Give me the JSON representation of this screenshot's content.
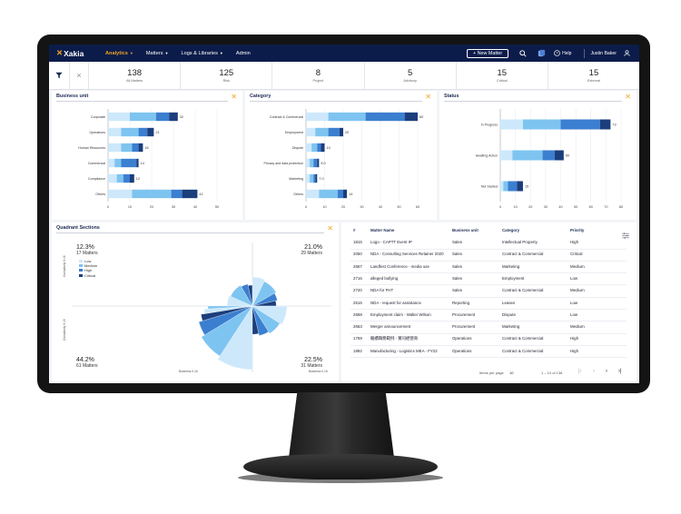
{
  "nav": {
    "logo": "Xakia",
    "items": [
      {
        "label": "Analytics",
        "active": true
      },
      {
        "label": "Matters",
        "active": false
      },
      {
        "label": "Logs & Libraries",
        "active": false
      },
      {
        "label": "Admin",
        "active": false
      }
    ],
    "new_matter": "+ New Matter",
    "help": "Help",
    "user": "Justin Baker"
  },
  "stats": [
    {
      "num": "138",
      "label": "All Matters"
    },
    {
      "num": "125",
      "label": "Risk"
    },
    {
      "num": "8",
      "label": "Project"
    },
    {
      "num": "5",
      "label": "Advisory"
    },
    {
      "num": "15",
      "label": "Critical"
    },
    {
      "num": "15",
      "label": "External"
    }
  ],
  "colors": {
    "c1": "#cde8fb",
    "c2": "#7ec4f0",
    "c3": "#3b7fd0",
    "c4": "#1b3e7c",
    "accent": "#f2a521",
    "nav": "#0c1c4a"
  },
  "business_unit": {
    "title": "Business unit",
    "chart_data": {
      "type": "bar",
      "orientation": "horizontal",
      "stacked": true,
      "categories": [
        "Corporate",
        "Operations",
        "Human Resources",
        "Commercial",
        "Compliance",
        "Others"
      ],
      "series": [
        {
          "values": [
            10,
            6,
            6,
            3,
            4,
            11
          ]
        },
        {
          "values": [
            12,
            8,
            5,
            3,
            3,
            18
          ]
        },
        {
          "values": [
            6,
            4,
            3,
            7,
            3,
            5
          ]
        },
        {
          "values": [
            4,
            3,
            2,
            1,
            2,
            7
          ]
        }
      ],
      "totals": [
        "32",
        "21",
        "16",
        "14",
        "12",
        "41"
      ],
      "xticks": [
        "0",
        "10",
        "20",
        "30",
        "40",
        "50"
      ],
      "xlim": [
        0,
        50
      ]
    }
  },
  "category": {
    "title": "Category",
    "chart_data": {
      "type": "bar",
      "orientation": "horizontal",
      "stacked": true,
      "categories": [
        "Contract & Commercial",
        "Employment",
        "Dispute",
        "Privacy and data protection",
        "Marketing",
        "Others"
      ],
      "series": [
        {
          "values": [
            12,
            5,
            3,
            2,
            2,
            7
          ]
        },
        {
          "values": [
            20,
            7,
            3,
            2,
            2,
            10
          ]
        },
        {
          "values": [
            21,
            6,
            2,
            2,
            1,
            3
          ]
        },
        {
          "values": [
            7,
            2,
            2,
            1,
            1,
            2
          ]
        }
      ],
      "totals": [
        "60",
        "20",
        "10",
        "5.0",
        "7.0",
        "14"
      ],
      "xticks": [
        "0",
        "10",
        "20",
        "30",
        "40",
        "50",
        "60"
      ],
      "xlim": [
        0,
        60
      ]
    }
  },
  "status": {
    "title": "Status",
    "chart_data": {
      "type": "bar",
      "orientation": "horizontal",
      "stacked": true,
      "categories": [
        "In Progress",
        "Awaiting Action",
        "Not Started"
      ],
      "series": [
        {
          "values": [
            15,
            8,
            2
          ]
        },
        {
          "values": [
            25,
            20,
            3
          ]
        },
        {
          "values": [
            26,
            8,
            6
          ]
        },
        {
          "values": [
            7,
            6,
            4
          ]
        }
      ],
      "totals": [
        "73",
        "50",
        "15"
      ],
      "xticks": [
        "0",
        "10",
        "20",
        "30",
        "40",
        "50",
        "60",
        "70",
        "80"
      ],
      "xlim": [
        0,
        80
      ]
    }
  },
  "quadrant": {
    "title": "Quadrant Sections",
    "legend": [
      "Low",
      "Medium",
      "High",
      "Critical"
    ],
    "q1": {
      "pct": "12.3%",
      "matters": "17 Matters"
    },
    "q2": {
      "pct": "21.0%",
      "matters": "29 Matters"
    },
    "q3": {
      "pct": "44.2%",
      "matters": "61 Matters"
    },
    "q4": {
      "pct": "22.5%",
      "matters": "31 Matters"
    },
    "axis_left_top": "Complexity 0.16",
    "axis_left_bottom": "Complexity 0.15",
    "axis_bottom_left": "Business 0.16",
    "axis_bottom_right": "Business 0.15",
    "chart_data": {
      "type": "pie",
      "quadrants": [
        "top-left",
        "top-right",
        "bottom-left",
        "bottom-right"
      ],
      "slices": [
        {
          "quadrant": "top-left",
          "values": [
            4,
            6,
            3,
            2
          ]
        },
        {
          "quadrant": "top-right",
          "values": [
            6,
            8,
            4,
            3
          ]
        },
        {
          "quadrant": "bottom-left",
          "values": [
            18,
            14,
            8,
            4,
            3,
            2
          ]
        },
        {
          "quadrant": "bottom-right",
          "values": [
            5,
            4,
            3,
            2
          ]
        }
      ]
    }
  },
  "table": {
    "headers": [
      "#",
      "Matter Name",
      "Business unit",
      "Category",
      "Priority"
    ],
    "rows": [
      [
        "1815",
        "Logo - CAPTT Event IP",
        "Sales",
        "Intellectual Property",
        "High"
      ],
      [
        "2050",
        "NDA - Consulting Services Retainer 2020",
        "Sales",
        "Contract & Commercial",
        "Critical"
      ],
      [
        "2667",
        "Landfest Conference - media use",
        "Sales",
        "Marketing",
        "Medium"
      ],
      [
        "2716",
        "alleged bullying",
        "Sales",
        "Employment",
        "Low"
      ],
      [
        "2720",
        "NDA for FHT",
        "Sales",
        "Contract & Commercial",
        "Medium"
      ],
      [
        "2516",
        "NDA - request for assistance",
        "Reporting",
        "Leases",
        "Low"
      ],
      [
        "2658",
        "Employment claim - Walter Wilson",
        "Procurement",
        "Dispute",
        "Low"
      ],
      [
        "2663",
        "Merger announcement",
        "Procurement",
        "Marketing",
        "Medium"
      ],
      [
        "1759",
        "繼續職務範例 - 實司經營商",
        "Operations",
        "Contract & Commercial",
        "High"
      ],
      [
        "1892",
        "Manufacturing - Logistics MEA - FY22",
        "Operations",
        "Contract & Commercial",
        "High"
      ]
    ],
    "pager": {
      "items_label": "Items per page",
      "items_value": "10",
      "range": "1 – 10 of 138"
    }
  }
}
